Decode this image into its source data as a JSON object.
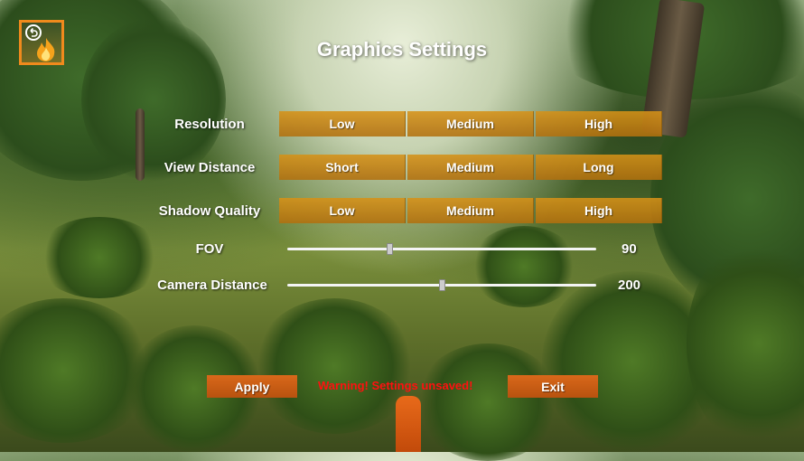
{
  "title": "Graphics Settings",
  "colors": {
    "accent": "#f08a1c",
    "option_bg": "#d69218",
    "button_bg": "#d9681a",
    "warning": "#ff1010"
  },
  "back_button": {
    "icon": "undo-arrow-icon",
    "overlay_icon": "fire-icon"
  },
  "settings": [
    {
      "label": "Resolution",
      "options": [
        "Low",
        "Medium",
        "High"
      ]
    },
    {
      "label": "View Distance",
      "options": [
        "Short",
        "Medium",
        "Long"
      ]
    },
    {
      "label": "Shadow Quality",
      "options": [
        "Low",
        "Medium",
        "High"
      ]
    }
  ],
  "sliders": [
    {
      "label": "FOV",
      "value": "90",
      "fraction": 0.33
    },
    {
      "label": "Camera Distance",
      "value": "200",
      "fraction": 0.5
    }
  ],
  "apply_label": "Apply",
  "exit_label": "Exit",
  "warning_text": "Warning! Settings unsaved!"
}
